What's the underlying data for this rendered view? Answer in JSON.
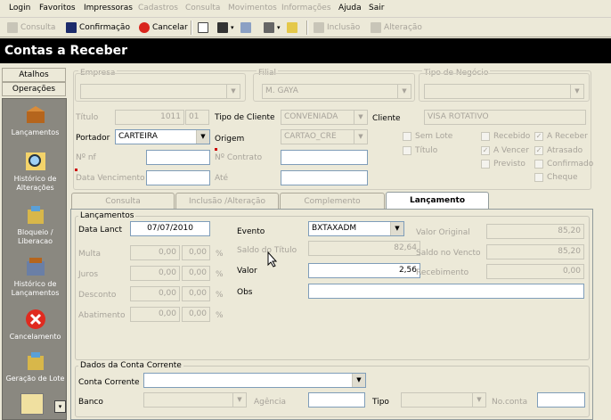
{
  "menu": [
    "Login",
    "Favoritos",
    "Impressoras",
    "Cadastros",
    "Consulta",
    "Movimentos",
    "Informações",
    "Ajuda",
    "Sair"
  ],
  "menu_enabled": [
    true,
    true,
    true,
    false,
    false,
    false,
    false,
    true,
    true
  ],
  "toolbar": {
    "consulta": "Consulta",
    "confirmacao": "Confirmação",
    "cancelar": "Cancelar",
    "inclusao": "Inclusão",
    "alteracao": "Alteração"
  },
  "window_title": "Contas a Receber",
  "sidebar": {
    "atalhos": "Atalhos",
    "operacoes": "Operações",
    "items": [
      "Lançamentos",
      "Histórico de Alterações",
      "Bloqueio / Liberacao",
      "Histórico de Lançamentos",
      "Cancelamento",
      "Geração de Lote"
    ]
  },
  "header": {
    "empresa_label": "Empresa",
    "empresa_value": "",
    "filial_label": "Filial",
    "filial_value": "M. GAYA",
    "tipo_negocio_label": "Tipo de Negócio",
    "tipo_negocio_value": "",
    "titulo_label": "Título",
    "titulo_value": "1011",
    "titulo_seq": "01",
    "tipo_cliente_label": "Tipo de Cliente",
    "tipo_cliente_value": "CONVENIADA",
    "cliente_label": "Cliente",
    "cliente_value": "VISA ROTATIVO",
    "portador_label": "Portador",
    "portador_value": "CARTEIRA",
    "origem_label": "Origem",
    "origem_value": "CARTAO_CRE",
    "nf_label": "Nº nf",
    "contrato_label": "Nº Contrato",
    "data_venc_label": "Data Vencimento",
    "ate_label": "Até"
  },
  "checks": [
    {
      "label": "Sem Lote",
      "checked": false
    },
    {
      "label": "Título",
      "checked": false
    },
    {
      "label": "Recebido",
      "checked": false
    },
    {
      "label": "A Vencer",
      "checked": true
    },
    {
      "label": "Previsto",
      "checked": false
    },
    {
      "label": "A Receber",
      "checked": true
    },
    {
      "label": "Atrasado",
      "checked": true
    },
    {
      "label": "Confirmado",
      "checked": false
    },
    {
      "label": "Cheque",
      "checked": false
    }
  ],
  "tabs": [
    "Consulta",
    "Inclusão /Alteração",
    "Complemento",
    "Lançamento"
  ],
  "lanc": {
    "group": "Lançamentos",
    "data_lanct_label": "Data Lanct",
    "data_lanct_value": "07/07/2010",
    "multa_label": "Multa",
    "juros_label": "Juros",
    "desconto_label": "Desconto",
    "abatimento_label": "Abatimento",
    "zero": "0,00",
    "pct": "%",
    "evento_label": "Evento",
    "evento_value": "BXTAXADM",
    "saldo_titulo_label": "Saldo do Título",
    "saldo_titulo_value": "82,64",
    "valor_label": "Valor",
    "valor_value": "2,56",
    "obs_label": "Obs",
    "obs_value": "",
    "valor_original_label": "Valor Original",
    "valor_original_value": "85,20",
    "saldo_vencto_label": "Saldo no Vencto",
    "saldo_vencto_value": "85,20",
    "recebimento_label": "Recebimento",
    "recebimento_value": "0,00"
  },
  "conta": {
    "group": "Dados da Conta Corrente",
    "conta_label": "Conta Corrente",
    "banco_label": "Banco",
    "agencia_label": "Agência",
    "tipo_label": "Tipo",
    "noconta_label": "No.conta"
  }
}
